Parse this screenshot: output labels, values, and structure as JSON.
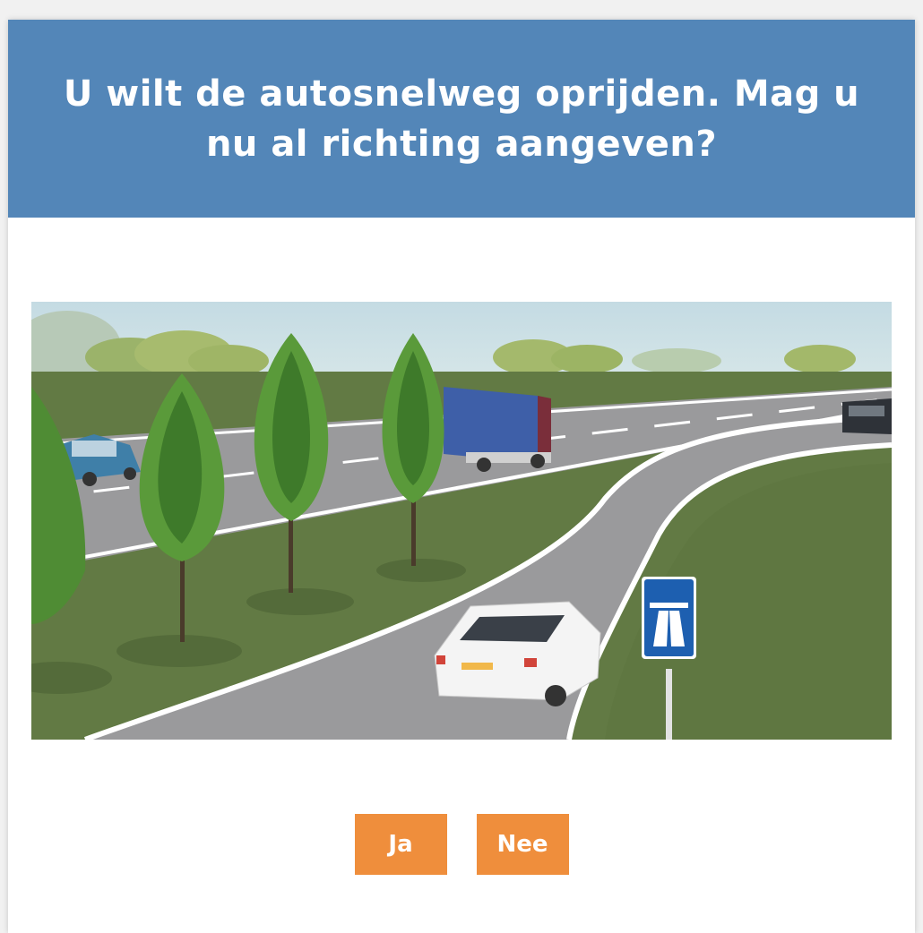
{
  "question": {
    "text": "U wilt de autosnelweg oprijden. Mag u nu al richting aangeven?"
  },
  "colors": {
    "header_bg": "#5386b8",
    "button_bg": "#ef8e3c",
    "text_on_color": "#ffffff"
  },
  "illustration": {
    "sign_icon": "motorway-sign-icon"
  },
  "answers": [
    {
      "label": "Ja"
    },
    {
      "label": "Nee"
    }
  ]
}
